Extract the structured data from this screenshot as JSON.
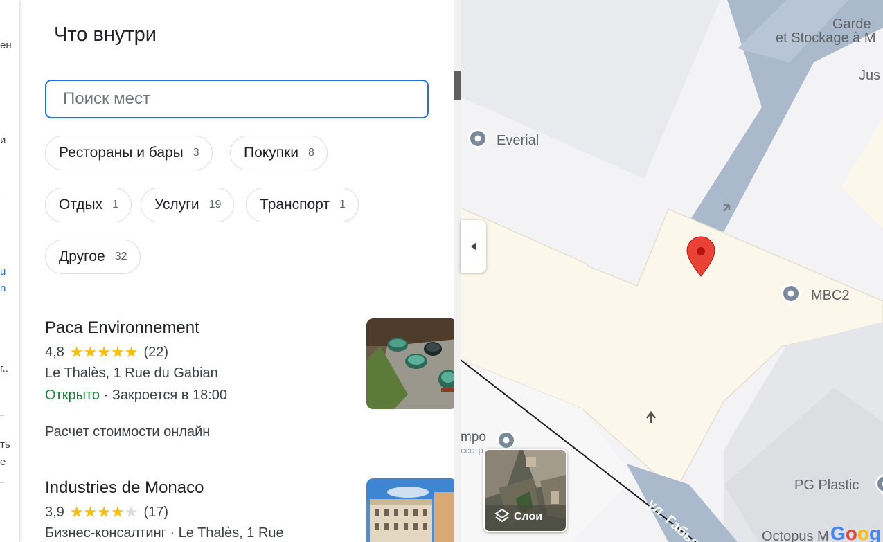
{
  "left_strip": {
    "fragments": [
      "ен",
      "и",
      "u",
      "n",
      "г..",
      "ть",
      "е"
    ]
  },
  "panel": {
    "title": "Что внутри",
    "search": {
      "placeholder": "Поиск мест",
      "value": ""
    },
    "chips": [
      {
        "label": "Рестораны и бары",
        "count": "3"
      },
      {
        "label": "Покупки",
        "count": "8"
      },
      {
        "label": "Отдых",
        "count": "1"
      },
      {
        "label": "Услуги",
        "count": "19"
      },
      {
        "label": "Транспорт",
        "count": "1"
      },
      {
        "label": "Другое",
        "count": "32"
      }
    ],
    "places": [
      {
        "name": "Paca Environnement",
        "rating": "4,8",
        "stars": 5,
        "reviews": "(22)",
        "address": "Le Thalès, 1 Rue du Gabian",
        "status": "Открыто",
        "hours": " · Закроется в 18:00",
        "extra": "Расчет стоимости онлайн"
      },
      {
        "name": "Industries de Monaco",
        "rating": "3,9",
        "stars": 4,
        "reviews": "(17)",
        "address": "Бизнес-консалтинг · Le Thalès, 1 Rue"
      }
    ]
  },
  "map": {
    "labels": {
      "garden_1": "Garde",
      "garden_2": "et Stockage à M",
      "jus": "Jus",
      "everial": "Everial",
      "mbc2": "MBC2",
      "mpo": "mpo",
      "mpo_sub": "ссстр",
      "pg_plastic": "PG Plastic",
      "street": "ул. Габьян",
      "octopus": "Octopus M"
    },
    "layers_label": "Слои",
    "google_logo": "Google"
  },
  "colors": {
    "accent": "#1a73e8",
    "open": "#188038",
    "star": "#fbbc04",
    "building": "#fcf7eb",
    "road": "#aab9cc",
    "pin": "#ea4335"
  }
}
